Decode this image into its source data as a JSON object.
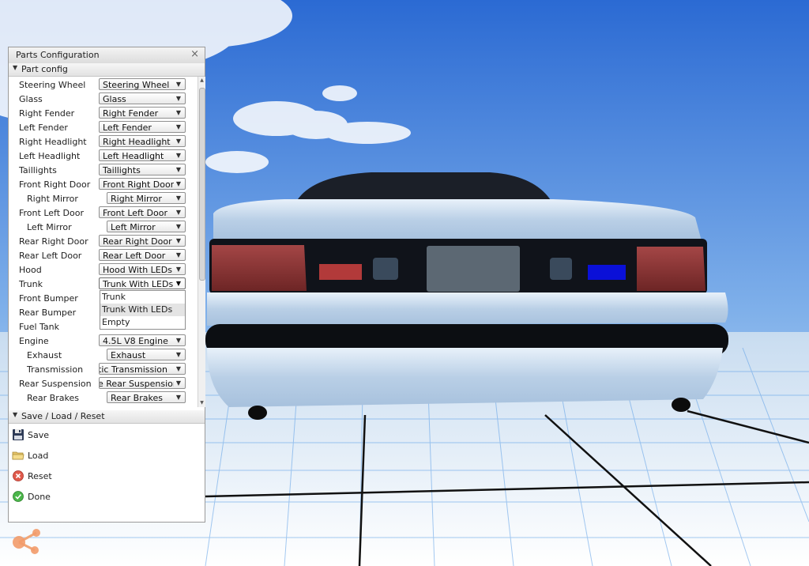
{
  "window": {
    "title": "Parts Configuration",
    "close_label": "×"
  },
  "part_config": {
    "header": "Part config",
    "rows": [
      {
        "label": "Steering Wheel",
        "value": "Steering Wheel"
      },
      {
        "label": "Glass",
        "value": "Glass"
      },
      {
        "label": "Right Fender",
        "value": "Right Fender"
      },
      {
        "label": "Left Fender",
        "value": "Left Fender"
      },
      {
        "label": "Right Headlight",
        "value": "Right Headlight"
      },
      {
        "label": "Left Headlight",
        "value": "Left Headlight"
      },
      {
        "label": "Taillights",
        "value": "Taillights"
      },
      {
        "label": "Front Right Door",
        "value": "Front Right Door"
      },
      {
        "label": "Right Mirror",
        "value": "Right Mirror"
      },
      {
        "label": "Front Left Door",
        "value": "Front Left Door"
      },
      {
        "label": "Left Mirror",
        "value": "Left Mirror"
      },
      {
        "label": "Rear Right Door",
        "value": "Rear Right Door"
      },
      {
        "label": "Rear Left Door",
        "value": "Rear Left Door"
      },
      {
        "label": "Hood",
        "value": "Hood With LEDs"
      },
      {
        "label": "Trunk",
        "value": "Trunk With LEDs"
      },
      {
        "label": "Front Bumper",
        "value": ""
      },
      {
        "label": "Rear Bumper",
        "value": ""
      },
      {
        "label": "Fuel Tank",
        "value": ""
      },
      {
        "label": "Engine",
        "value": "4.5L V8 Engine"
      },
      {
        "label": "Exhaust",
        "value": "Exhaust"
      },
      {
        "label": "Transmission",
        "value": "tic Transmission"
      },
      {
        "label": "Rear Suspension",
        "value": "e Rear Suspension"
      },
      {
        "label": "Rear Brakes",
        "value": "Rear Brakes"
      }
    ],
    "trunk_dropdown": {
      "options": [
        "Trunk",
        "Trunk With LEDs",
        "Empty"
      ],
      "highlighted": "Trunk With LEDs"
    }
  },
  "save_load_reset": {
    "header": "Save / Load / Reset",
    "actions": [
      {
        "label": "Save",
        "icon": "floppy-disk-icon"
      },
      {
        "label": "Load",
        "icon": "folder-icon"
      },
      {
        "label": "Reset",
        "icon": "reset-icon"
      },
      {
        "label": "Done",
        "icon": "checkmark-icon"
      }
    ]
  },
  "colors": {
    "sky_top": "#2a6fd6",
    "sky_horizon": "#cfe3f8",
    "car_body": "#c4d6ea",
    "taillight": "#8a2c2c",
    "led_red": "#b53a3a",
    "led_blue": "#0c12d6"
  }
}
